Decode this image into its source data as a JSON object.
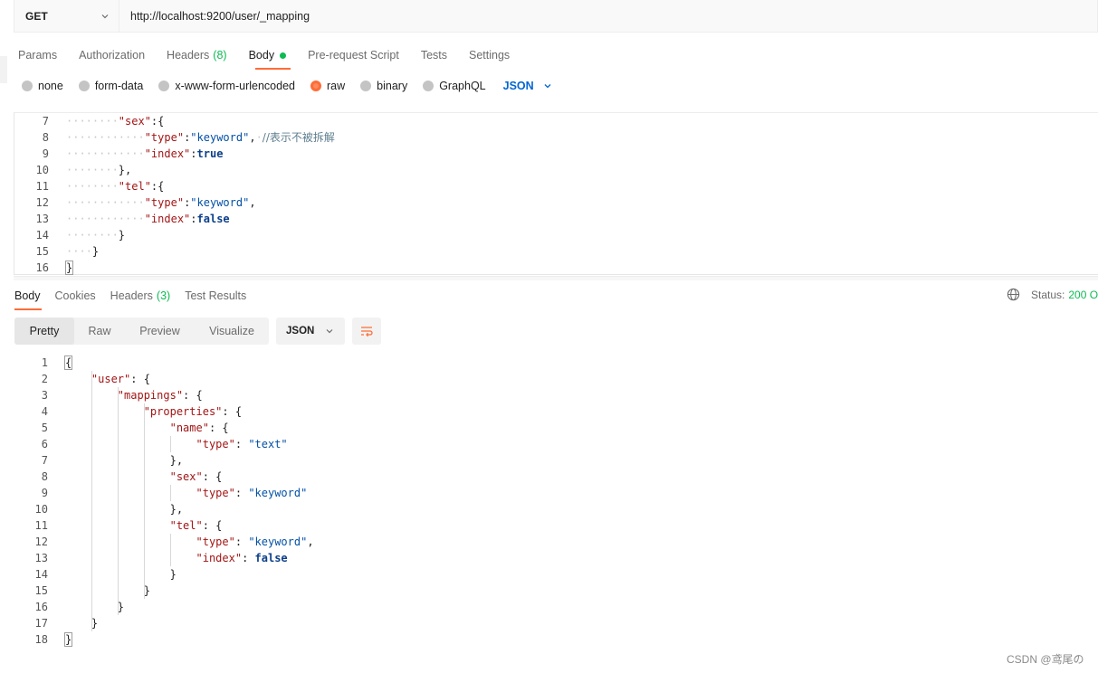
{
  "request": {
    "method": "GET",
    "url": "http://localhost:9200/user/_mapping"
  },
  "request_tabs": [
    {
      "label": "Params"
    },
    {
      "label": "Authorization"
    },
    {
      "label": "Headers",
      "count": "(8)"
    },
    {
      "label": "Body"
    },
    {
      "label": "Pre-request Script"
    },
    {
      "label": "Tests"
    },
    {
      "label": "Settings"
    }
  ],
  "body_types": [
    "none",
    "form-data",
    "x-www-form-urlencoded",
    "raw",
    "binary",
    "GraphQL"
  ],
  "body_format": "JSON",
  "request_line_numbers": [
    "7",
    "8",
    "9",
    "10",
    "11",
    "12",
    "13",
    "14",
    "15",
    "16"
  ],
  "request_comment": "//表示不被拆解",
  "response_tabs": [
    {
      "label": "Body"
    },
    {
      "label": "Cookies"
    },
    {
      "label": "Headers",
      "count": "(3)"
    },
    {
      "label": "Test Results"
    }
  ],
  "status": {
    "label": "Status:",
    "value": "200 O"
  },
  "view_modes": [
    "Pretty",
    "Raw",
    "Preview",
    "Visualize"
  ],
  "response_format": "JSON",
  "response_line_numbers": [
    "1",
    "2",
    "3",
    "4",
    "5",
    "6",
    "7",
    "8",
    "9",
    "10",
    "11",
    "12",
    "13",
    "14",
    "15",
    "16",
    "17",
    "18"
  ],
  "watermark": "CSDN @鸢尾の"
}
